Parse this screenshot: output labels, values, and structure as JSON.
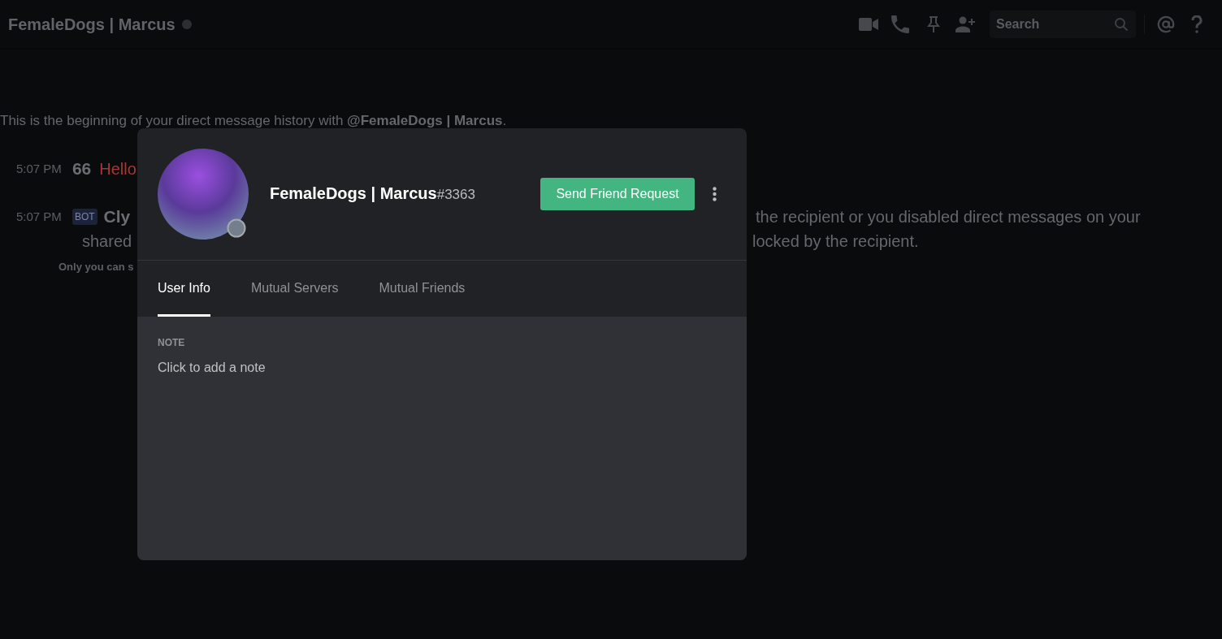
{
  "header": {
    "title": "FemaleDogs | Marcus",
    "online": false
  },
  "toolbar": {
    "search": {
      "placeholder": "Search"
    }
  },
  "chat": {
    "intro": "This is the beginning of your direct message history with **@FemaleDogs | Marcus**.",
    "messages": [
      {
        "time": "5:07 PM",
        "author": "66",
        "failed": true,
        "lines": [
          {
            "left": "Hello"
          }
        ]
      },
      {
        "time": "5:07 PM",
        "badge": "BOT",
        "author": "Cly",
        "failed": false,
        "lines": [
          {
            "right": "the recipient or you disabled direct messages on your"
          },
          {
            "left": "shared",
            "right": "locked by the recipient."
          }
        ],
        "footer": "Only you can s"
      }
    ]
  },
  "modal": {
    "user": {
      "name": "FemaleDogs | Marcus",
      "discriminator": "#3363",
      "online": false
    },
    "action_button": "Send Friend Request",
    "tabs": [
      {
        "label": "User Info",
        "selected": true
      },
      {
        "label": "Mutual Servers",
        "selected": false
      },
      {
        "label": "Mutual Friends",
        "selected": false
      }
    ],
    "note": {
      "heading": "NOTE",
      "placeholder": "Click to add a note"
    }
  }
}
